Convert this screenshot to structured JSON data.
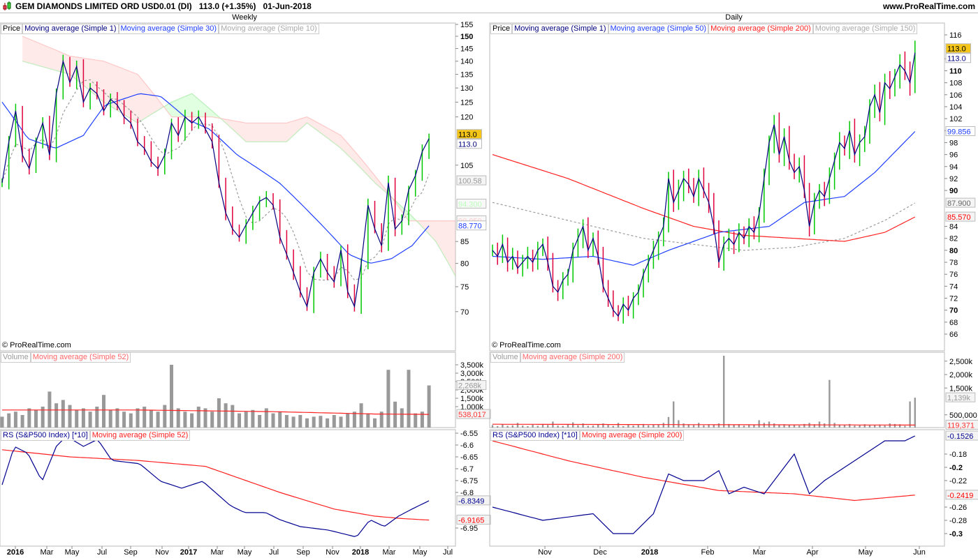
{
  "header": {
    "title": "GEM DIAMONDS LIMITED ORD USD0.01 (DI)",
    "price": "113.0 (+1.35%)",
    "date": "01-Jun-2018",
    "site": "www.ProRealTime.com"
  },
  "colors": {
    "up": "#00c800",
    "down": "#e0003c",
    "close_line": "#000080",
    "ma_blue": "#1f3fff",
    "ma_gray": "#999999",
    "ma_red": "#ff2020",
    "rs": "#000090",
    "volume": "#999999",
    "tag_yellow": "#f5c518"
  },
  "weekly": {
    "title": "Weekly",
    "legend": [
      "Price",
      "Moving average (Simple 1)",
      "Moving average (Simple 30)",
      "Moving average (Simple 10)"
    ],
    "copyright": "© ProRealTime.com",
    "volume_legend": [
      "Volume",
      "Moving average (Simple 52)"
    ],
    "rs_legend": [
      "RS (S&P500 Index) [*10]",
      "Moving average (Simple 52)"
    ],
    "x_labels": [
      "2016",
      "Mar",
      "May",
      "Jul",
      "Sep",
      "Nov",
      "2017",
      "Mar",
      "May",
      "Jul",
      "Sep",
      "Nov",
      "2018",
      "Mar",
      "May",
      "Jul"
    ],
    "price_ticks": [
      155,
      150,
      145,
      140,
      135,
      130,
      125,
      120,
      105,
      85,
      80,
      75,
      70
    ],
    "volume_ticks": [
      "3,500k",
      "3,000k",
      "2,500k",
      "2,000k",
      "1,500k",
      "1,000k"
    ],
    "rs_ticks": [
      "-6.55",
      "-6.6",
      "-6.65",
      "-6.7",
      "-6.75",
      "-6.8",
      "-6.95"
    ],
    "tags": {
      "last": "113.0",
      "ma1": "113.0",
      "ma10": "100.58",
      "span_a": "94.300",
      "span_b": "90.050",
      "ma30": "88.770",
      "vol": "2,268k",
      "vol_ma": "538,017",
      "rs": "-6.8349",
      "rs_ma": "-6.9165"
    }
  },
  "daily": {
    "title": "Daily",
    "legend": [
      "Price",
      "Moving average (Simple 1)",
      "Moving average (Simple 50)",
      "Moving average (Simple 200)",
      "Moving average (Simple 150)"
    ],
    "copyright": "© ProRealTime.com",
    "volume_legend": [
      "Volume",
      "Moving average (Simple 200)"
    ],
    "rs_legend": [
      "RS (S&P500 Index) [*10]",
      "Moving average (Simple 200)"
    ],
    "x_labels": [
      "Nov",
      "Dec",
      "2018",
      "Feb",
      "Mar",
      "Apr",
      "May",
      "Jun"
    ],
    "price_ticks": [
      116,
      112,
      110,
      108,
      106,
      104,
      102,
      100,
      98,
      96,
      94,
      92,
      90,
      84,
      82,
      80,
      78,
      76,
      74,
      72,
      70,
      68,
      66
    ],
    "volume_ticks": [
      "2,500k",
      "2,000k",
      "1,500k",
      "500,000"
    ],
    "rs_ticks": [
      "-0.18",
      "-0.2",
      "-0.22",
      "-0.26",
      "-0.28",
      "-0.3"
    ],
    "tags": {
      "last": "113.0",
      "ma1": "113.0",
      "ma50": "99.856",
      "ma150": "87.900",
      "ma200": "85.570",
      "vol": "1,139k",
      "vol_ma": "119,371",
      "rs": "-0.1526",
      "rs_ma": "-0.2419"
    }
  },
  "chart_data": [
    {
      "type": "line",
      "title": "GEM DIAMONDS Weekly",
      "ylabel": "Price",
      "yscale": "log",
      "ylim": [
        66,
        156
      ],
      "closes": [
        100,
        112,
        122,
        108,
        104,
        112,
        118,
        108,
        128,
        140,
        132,
        138,
        125,
        130,
        128,
        122,
        126,
        124,
        120,
        118,
        112,
        110,
        106,
        104,
        108,
        118,
        114,
        120,
        118,
        120,
        116,
        112,
        100,
        92,
        88,
        86,
        89,
        92,
        95,
        96,
        94,
        86,
        82,
        78,
        74,
        71,
        78,
        81,
        78,
        76,
        83,
        74,
        71,
        80,
        94,
        88,
        84,
        100,
        88,
        90,
        98,
        102,
        109,
        113
      ],
      "ma30": [
        [
          0,
          125
        ],
        [
          3.8,
          113
        ],
        [
          7.9,
          110
        ],
        [
          12,
          114
        ],
        [
          15.2,
          124
        ],
        [
          20.3,
          128
        ],
        [
          23.4,
          127
        ],
        [
          27.5,
          119
        ],
        [
          30.6,
          116
        ],
        [
          34.7,
          108
        ],
        [
          40.9,
          100
        ],
        [
          46,
          91
        ],
        [
          51.2,
          82
        ],
        [
          54.3,
          80
        ],
        [
          57.4,
          81
        ],
        [
          60.5,
          84
        ],
        [
          63,
          88.77
        ]
      ],
      "cloud_a": [
        [
          3,
          140
        ],
        [
          10,
          135
        ],
        [
          15,
          125
        ],
        [
          20,
          118
        ],
        [
          25,
          125
        ],
        [
          28,
          128
        ],
        [
          31,
          122
        ],
        [
          36,
          112
        ],
        [
          42,
          112
        ],
        [
          45,
          118
        ],
        [
          50,
          110
        ],
        [
          55,
          100
        ],
        [
          60,
          92
        ],
        [
          64,
          85
        ],
        [
          67,
          77
        ]
      ],
      "cloud_b": [
        [
          3,
          150
        ],
        [
          10,
          142
        ],
        [
          15,
          140
        ],
        [
          20,
          135
        ],
        [
          25,
          120
        ],
        [
          28,
          120
        ],
        [
          31,
          120
        ],
        [
          36,
          118
        ],
        [
          42,
          118
        ],
        [
          45,
          120
        ],
        [
          50,
          114
        ],
        [
          55,
          102
        ],
        [
          60,
          90
        ],
        [
          64,
          90
        ],
        [
          67,
          90
        ]
      ],
      "volume_k": [
        400,
        600,
        700,
        500,
        900,
        800,
        1000,
        1900,
        1200,
        1400,
        1100,
        800,
        900,
        700,
        1000,
        1700,
        800,
        900,
        700,
        600,
        900,
        1000,
        800,
        700,
        1100,
        3500,
        900,
        700,
        600,
        1000,
        900,
        700,
        1500,
        1200,
        1100,
        600,
        700,
        800,
        500,
        900,
        600,
        700,
        500,
        400,
        500,
        300,
        400,
        450,
        300,
        500,
        400,
        600,
        700,
        1200,
        600,
        300,
        700,
        3200,
        1300,
        900,
        3200,
        600,
        700,
        2268
      ],
      "volume_ma_k": [
        [
          0,
          800
        ],
        [
          20,
          800
        ],
        [
          40,
          700
        ],
        [
          55,
          560
        ],
        [
          63,
          538
        ]
      ],
      "rs": [
        [
          0,
          -6.768
        ],
        [
          1.8,
          -6.606
        ],
        [
          3.8,
          -6.635
        ],
        [
          5.9,
          -6.753
        ],
        [
          8,
          -6.606
        ],
        [
          9.5,
          -6.562
        ],
        [
          12,
          -6.606
        ],
        [
          14.1,
          -6.576
        ],
        [
          16.2,
          -6.665
        ],
        [
          20.3,
          -6.679
        ],
        [
          23.4,
          -6.753
        ],
        [
          26.5,
          -6.782
        ],
        [
          29.6,
          -6.753
        ],
        [
          33.7,
          -6.856
        ],
        [
          35.8,
          -6.885
        ],
        [
          38.9,
          -6.885
        ],
        [
          41,
          -6.915
        ],
        [
          44,
          -6.944
        ],
        [
          48.2,
          -6.959
        ],
        [
          52.3,
          -6.988
        ],
        [
          54.3,
          -6.915
        ],
        [
          56.4,
          -6.944
        ],
        [
          58.5,
          -6.9
        ],
        [
          60.5,
          -6.87
        ],
        [
          63,
          -6.835
        ]
      ],
      "rs_ma": [
        [
          0,
          -6.62
        ],
        [
          10,
          -6.65
        ],
        [
          20,
          -6.665
        ],
        [
          30,
          -6.69
        ],
        [
          41,
          -6.8
        ],
        [
          49,
          -6.87
        ],
        [
          55,
          -6.9
        ],
        [
          59,
          -6.91
        ],
        [
          63,
          -6.9165
        ]
      ]
    },
    {
      "type": "line",
      "title": "GEM DIAMONDS Daily",
      "ylabel": "Price",
      "yscale": "linear",
      "ylim": [
        64,
        118
      ],
      "closes": [
        80,
        79,
        81,
        78,
        79,
        77,
        78,
        79,
        78,
        80,
        81,
        78,
        74,
        73,
        75,
        76,
        80,
        82,
        84,
        80,
        82,
        79,
        74,
        72,
        70,
        69,
        71,
        70,
        72,
        73,
        76,
        78,
        80,
        82,
        84,
        92,
        88,
        90,
        92,
        91,
        89,
        92,
        90,
        88,
        84,
        78,
        81,
        82,
        81,
        83,
        82,
        84,
        83,
        86,
        92,
        98,
        101,
        96,
        99,
        95,
        93,
        94,
        90,
        84,
        88,
        90,
        89,
        92,
        95,
        98,
        97,
        100,
        96,
        98,
        99,
        104,
        106,
        103,
        108,
        107,
        109,
        111,
        110,
        108,
        113
      ],
      "ma50": [
        [
          0,
          79
        ],
        [
          10,
          78.5
        ],
        [
          20,
          79
        ],
        [
          28,
          77.5
        ],
        [
          35,
          80
        ],
        [
          45,
          83
        ],
        [
          55,
          84
        ],
        [
          62,
          88
        ],
        [
          70,
          89
        ],
        [
          76,
          93
        ],
        [
          84,
          99.856
        ]
      ],
      "ma150": [
        [
          0,
          88
        ],
        [
          15,
          85
        ],
        [
          30,
          82
        ],
        [
          40,
          81
        ],
        [
          50,
          80
        ],
        [
          60,
          80.5
        ],
        [
          70,
          82
        ],
        [
          78,
          85
        ],
        [
          84,
          87.9
        ]
      ],
      "ma200": [
        [
          0,
          96
        ],
        [
          15,
          92
        ],
        [
          30,
          87
        ],
        [
          40,
          84
        ],
        [
          50,
          82.5
        ],
        [
          60,
          82
        ],
        [
          70,
          81.5
        ],
        [
          78,
          83
        ],
        [
          84,
          85.57
        ]
      ],
      "volume_k": [
        120,
        80,
        150,
        90,
        110,
        200,
        100,
        80,
        130,
        90,
        160,
        120,
        250,
        100,
        90,
        140,
        220,
        110,
        180,
        90,
        100,
        130,
        180,
        120,
        90,
        200,
        80,
        150,
        100,
        120,
        160,
        110,
        140,
        130,
        200,
        420,
        1000,
        300,
        180,
        150,
        120,
        200,
        110,
        150,
        120,
        180,
        2700,
        160,
        130,
        150,
        100,
        120,
        140,
        300,
        200,
        250,
        180,
        130,
        150,
        120,
        140,
        100,
        160,
        200,
        150,
        250,
        180,
        1800,
        200,
        140,
        120,
        160,
        100,
        110,
        150,
        130,
        120,
        140,
        100,
        180,
        160,
        150,
        90,
        1000,
        1139
      ],
      "volume_ma_k": [
        [
          0,
          150
        ],
        [
          84,
          119
        ]
      ],
      "rs": [
        [
          0,
          -0.26
        ],
        [
          5,
          -0.27
        ],
        [
          10,
          -0.28
        ],
        [
          20,
          -0.27
        ],
        [
          24,
          -0.3
        ],
        [
          28,
          -0.3
        ],
        [
          32,
          -0.27
        ],
        [
          35,
          -0.21
        ],
        [
          38,
          -0.22
        ],
        [
          42,
          -0.22
        ],
        [
          45,
          -0.205
        ],
        [
          47,
          -0.24
        ],
        [
          50,
          -0.23
        ],
        [
          54,
          -0.24
        ],
        [
          58,
          -0.2
        ],
        [
          60,
          -0.18
        ],
        [
          63,
          -0.24
        ],
        [
          66,
          -0.22
        ],
        [
          70,
          -0.2
        ],
        [
          74,
          -0.18
        ],
        [
          78,
          -0.16
        ],
        [
          82,
          -0.16
        ],
        [
          84,
          -0.1526
        ]
      ],
      "rs_ma": [
        [
          0,
          -0.16
        ],
        [
          15,
          -0.19
        ],
        [
          30,
          -0.215
        ],
        [
          45,
          -0.235
        ],
        [
          60,
          -0.24
        ],
        [
          72,
          -0.25
        ],
        [
          84,
          -0.2419
        ]
      ]
    }
  ]
}
